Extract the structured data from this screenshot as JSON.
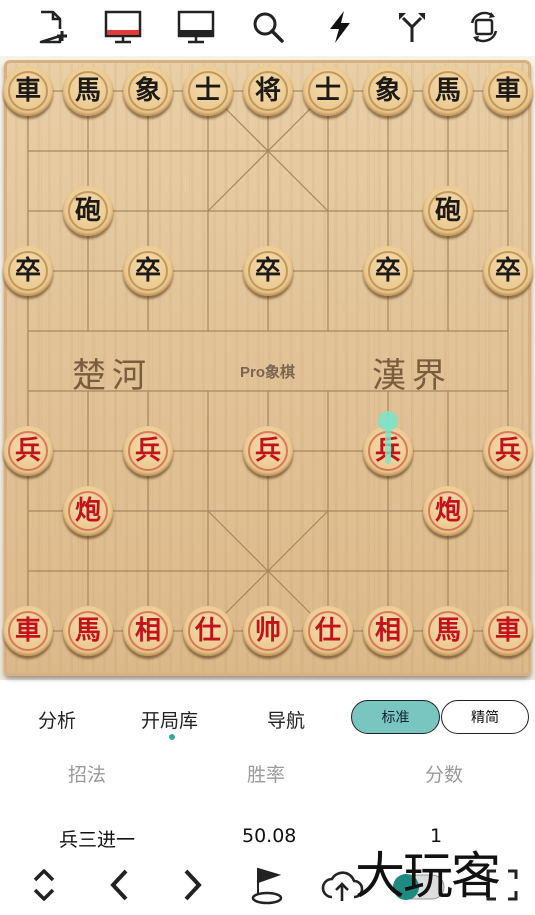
{
  "toolbar": {
    "icons": [
      "new-document-icon",
      "red-board-monitor-icon",
      "black-board-monitor-icon",
      "search-icon",
      "flash-icon",
      "branch-icon",
      "rotate-board-icon"
    ]
  },
  "board": {
    "river_left": "楚河",
    "river_mid": "Pro象棋",
    "river_right": "漢界",
    "black_pieces": [
      {
        "glyph": "車",
        "file": 0,
        "rank": 0
      },
      {
        "glyph": "馬",
        "file": 1,
        "rank": 0
      },
      {
        "glyph": "象",
        "file": 2,
        "rank": 0
      },
      {
        "glyph": "士",
        "file": 3,
        "rank": 0
      },
      {
        "glyph": "将",
        "file": 4,
        "rank": 0
      },
      {
        "glyph": "士",
        "file": 5,
        "rank": 0
      },
      {
        "glyph": "象",
        "file": 6,
        "rank": 0
      },
      {
        "glyph": "馬",
        "file": 7,
        "rank": 0
      },
      {
        "glyph": "車",
        "file": 8,
        "rank": 0
      },
      {
        "glyph": "砲",
        "file": 1,
        "rank": 2
      },
      {
        "glyph": "砲",
        "file": 7,
        "rank": 2
      },
      {
        "glyph": "卒",
        "file": 0,
        "rank": 3
      },
      {
        "glyph": "卒",
        "file": 2,
        "rank": 3
      },
      {
        "glyph": "卒",
        "file": 4,
        "rank": 3
      },
      {
        "glyph": "卒",
        "file": 6,
        "rank": 3
      },
      {
        "glyph": "卒",
        "file": 8,
        "rank": 3
      }
    ],
    "red_pieces": [
      {
        "glyph": "兵",
        "file": 0,
        "rank": 6
      },
      {
        "glyph": "兵",
        "file": 2,
        "rank": 6
      },
      {
        "glyph": "兵",
        "file": 4,
        "rank": 6
      },
      {
        "glyph": "兵",
        "file": 6,
        "rank": 6
      },
      {
        "glyph": "兵",
        "file": 8,
        "rank": 6
      },
      {
        "glyph": "炮",
        "file": 1,
        "rank": 7
      },
      {
        "glyph": "炮",
        "file": 7,
        "rank": 7
      },
      {
        "glyph": "車",
        "file": 0,
        "rank": 9
      },
      {
        "glyph": "馬",
        "file": 1,
        "rank": 9
      },
      {
        "glyph": "相",
        "file": 2,
        "rank": 9
      },
      {
        "glyph": "仕",
        "file": 3,
        "rank": 9
      },
      {
        "glyph": "帅",
        "file": 4,
        "rank": 9
      },
      {
        "glyph": "仕",
        "file": 5,
        "rank": 9
      },
      {
        "glyph": "相",
        "file": 6,
        "rank": 9
      },
      {
        "glyph": "馬",
        "file": 7,
        "rank": 9
      },
      {
        "glyph": "車",
        "file": 8,
        "rank": 9
      }
    ],
    "hint_arrow": {
      "from": {
        "file": 6,
        "rank": 6
      },
      "to": {
        "file": 6,
        "rank": 5
      },
      "color": "#7ee3c4"
    }
  },
  "tabs": {
    "items": [
      "分析",
      "开局库",
      "导航"
    ],
    "active_index": 1,
    "toggle": {
      "left": "标准",
      "right": "精简",
      "active": "left"
    },
    "accent": "#79c6c0"
  },
  "table": {
    "headers": [
      "招法",
      "胜率",
      "分数"
    ],
    "rows": [
      {
        "move": "兵三进一",
        "winrate": "50.08",
        "score": "1"
      }
    ]
  },
  "bottom_bar": {
    "icons": [
      "up-down-icon",
      "chevron-left-icon",
      "chevron-right-icon",
      "flag-icon",
      "cloud-upload-icon",
      "toggle-switch-icon",
      "fullscreen-icon"
    ],
    "watermark": "大玩客"
  }
}
